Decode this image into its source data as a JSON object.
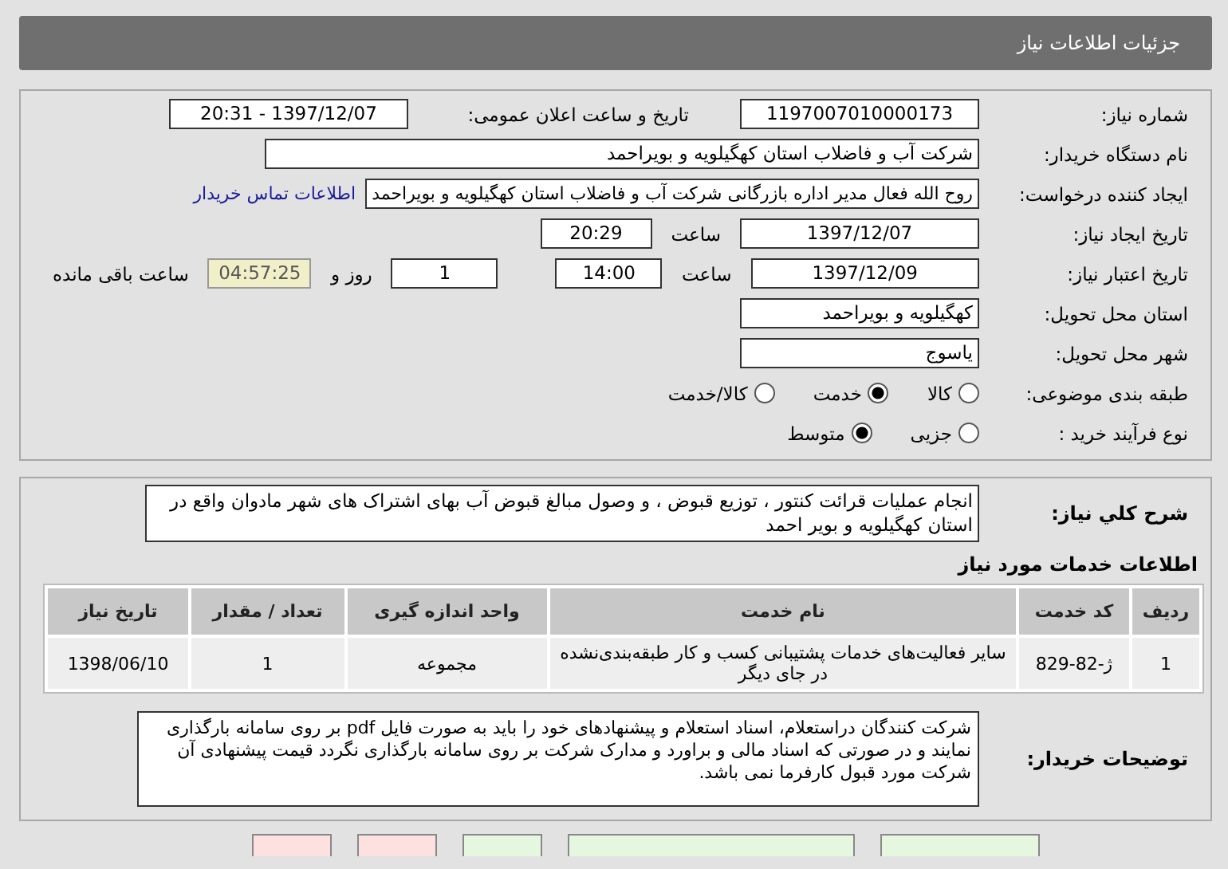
{
  "header": {
    "title": "جزئیات اطلاعات نیاز"
  },
  "need_number": {
    "label": "شماره نیاز:",
    "value": "1197007010000173"
  },
  "announce": {
    "label": "تاریخ و ساعت اعلان عمومی:",
    "value": "1397/12/07 - 20:31"
  },
  "buyer_org": {
    "label": "نام دستگاه خریدار:",
    "value": "شرکت آب و فاضلاب استان کهگیلویه و بویراحمد"
  },
  "requester": {
    "label": "ایجاد کننده درخواست:",
    "value": "روح الله فعال مدیر اداره بازرگانی شرکت آب و فاضلاب استان کهگیلویه و بویراحمد",
    "link": "اطلاعات تماس خریدار"
  },
  "created": {
    "label": "تاریخ ایجاد نیاز:",
    "date": "1397/12/07",
    "time_label": "ساعت",
    "time": "20:29"
  },
  "validity": {
    "label": "تاریخ اعتبار نیاز:",
    "date": "1397/12/09",
    "time_label": "ساعت",
    "time": "14:00",
    "days": "1",
    "days_label": "روز و",
    "remaining": "04:57:25",
    "remaining_label": "ساعت باقی مانده"
  },
  "province": {
    "label": "استان محل تحویل:",
    "value": "کهگیلویه و بویراحمد"
  },
  "city": {
    "label": "شهر محل تحویل:",
    "value": "یاسوج"
  },
  "category": {
    "label": "طبقه بندی موضوعی:",
    "options": [
      {
        "label": "کالا",
        "selected": false
      },
      {
        "label": "خدمت",
        "selected": true
      },
      {
        "label": "کالا/خدمت",
        "selected": false
      }
    ]
  },
  "process": {
    "label": "نوع فرآیند خرید :",
    "options": [
      {
        "label": "جزیی",
        "selected": false
      },
      {
        "label": "متوسط",
        "selected": true
      }
    ]
  },
  "summary": {
    "label": "شرح کلي نياز:",
    "value": "انجام عملیات قرائت کنتور ، توزیع قبوض ، و وصول مبالغ قبوض آب بهای اشتراک های شهر مادوان واقع در استان کهگیلویه و بویر احمد"
  },
  "services": {
    "title": "اطلاعات خدمات مورد نیاز",
    "columns": [
      "ردیف",
      "کد خدمت",
      "نام خدمت",
      "واحد اندازه گیری",
      "تعداد / مقدار",
      "تاریخ نیاز"
    ],
    "rows": [
      [
        "1",
        "ژ-82-829",
        "سایر فعالیت‌های خدمات پشتیبانی کسب و کار طبقه‌بندی‌نشده در جای دیگر",
        "مجموعه",
        "1",
        "1398/06/10"
      ]
    ]
  },
  "notes": {
    "label": "توضیحات خریدار:",
    "value": "شرکت کنندگان دراستعلام، اسناد استعلام و پیشنهادهای خود را باید به صورت فایل pdf بر روی سامانه بارگذاری نمایند و در صورتی که اسناد مالی و براورد و مدارک شرکت بر روی سامانه بارگذاری نگردد قیمت پیشنهادی آن شرکت مورد قبول کارفرما نمی باشد."
  },
  "bottom_buttons": [
    {
      "kind": "green"
    },
    {
      "kind": "green"
    },
    {
      "kind": "green"
    },
    {
      "kind": "red"
    },
    {
      "kind": "red"
    }
  ]
}
